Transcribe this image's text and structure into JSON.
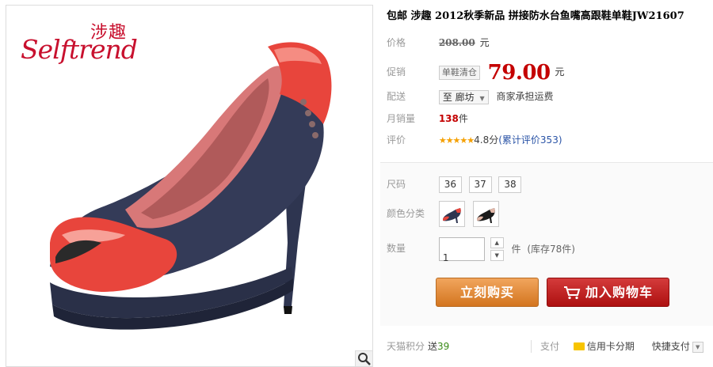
{
  "brand": {
    "cn": "涉趣",
    "en": "Selftrend"
  },
  "product": {
    "title": "包邮 涉趣 2012秋季新品 拼接防水台鱼嘴高跟鞋单鞋JW21607"
  },
  "price": {
    "label": "价格",
    "value": "208.00",
    "unit": "元"
  },
  "promo": {
    "label": "促销",
    "tag": "单鞋清仓",
    "value": "79.00",
    "unit": "元"
  },
  "shipping": {
    "label": "配送",
    "to": "至",
    "city": "廊坊",
    "note": "商家承担运费"
  },
  "sales": {
    "label": "月销量",
    "count": "138",
    "unit": "件"
  },
  "rating": {
    "label": "评价",
    "stars": "★★★★★",
    "score": "4.8分",
    "open": "(",
    "link": "累计评价353",
    "close": ")"
  },
  "sizes": {
    "label": "尺码",
    "options": [
      "36",
      "37",
      "38"
    ]
  },
  "colors": {
    "label": "颜色分类"
  },
  "quantity": {
    "label": "数量",
    "value": "1",
    "unit": "件",
    "stock": "(库存78件)"
  },
  "buttons": {
    "buy": "立刻购买",
    "cart": "加入购物车"
  },
  "footer": {
    "points_label": "天猫积分",
    "points_send": "送",
    "points_value": "39",
    "pay_label": "支付",
    "credit": "信用卡分期",
    "fast_pay": "快捷支付"
  },
  "colors_theme": {
    "price_red": "#c40000",
    "buy_orange": "#e08a3a",
    "cart_red": "#c02020",
    "shoe_red": "#e8453c",
    "denim": "#2e3550"
  }
}
